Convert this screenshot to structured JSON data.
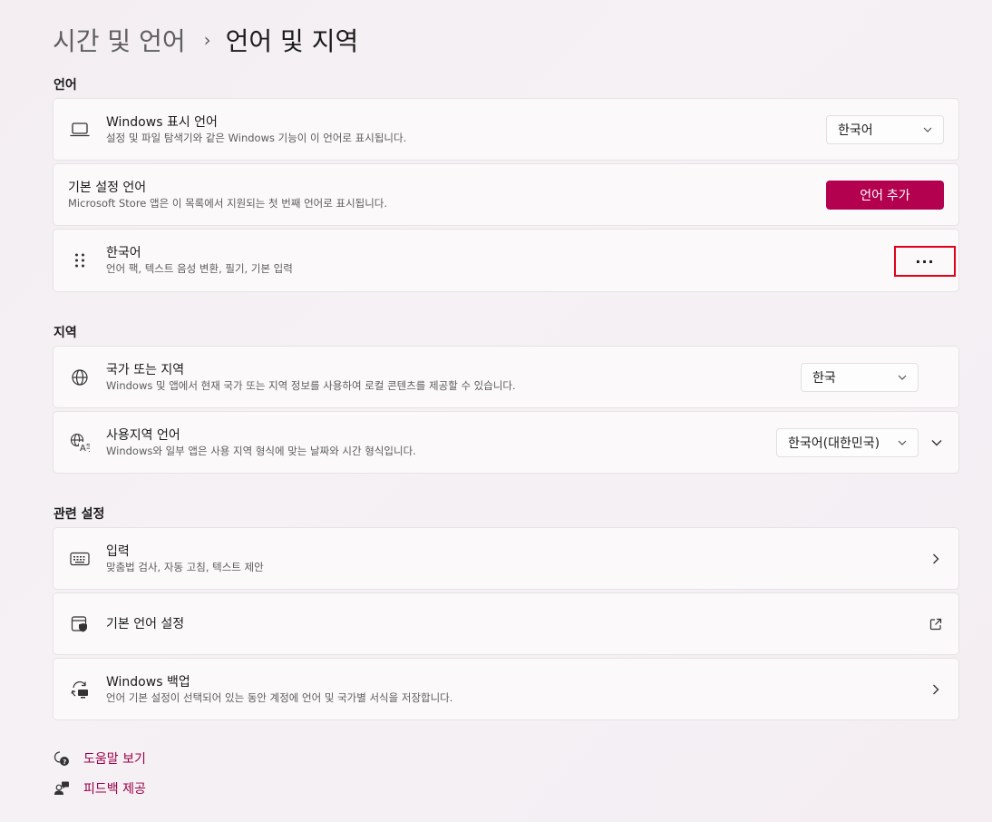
{
  "breadcrumb": {
    "parent": "시간 및 언어",
    "separator": "›",
    "current": "언어 및 지역"
  },
  "sections": {
    "language": "언어",
    "region": "지역",
    "related": "관련 설정"
  },
  "display_language": {
    "title": "Windows 표시 언어",
    "subtitle": "설정 및 파일 탐색기와 같은 Windows 기능이 이 언어로 표시됩니다.",
    "value": "한국어",
    "icon": "laptop-icon"
  },
  "preferred_languages": {
    "title": "기본 설정 언어",
    "subtitle": "Microsoft Store 앱은 이 목록에서 지원되는 첫 번째 언어로 표시됩니다.",
    "add_button": "언어 추가"
  },
  "korean_language": {
    "title": "한국어",
    "subtitle": "언어 팩, 텍스트 음성 변환, 필기, 기본 입력",
    "more": "···",
    "icon": "drag-handle-icon"
  },
  "country_region": {
    "title": "국가 또는 지역",
    "subtitle": "Windows 및 앱에서 현재 국가 또는 지역 정보를 사용하여 로컬 콘텐츠를 제공할 수 있습니다.",
    "value": "한국",
    "icon": "globe-icon"
  },
  "regional_format": {
    "title": "사용지역 언어",
    "subtitle": "Windows와 일부 앱은 사용 지역 형식에 맞는 날짜와 시간 형식입니다.",
    "value": "한국어(대한민국)",
    "icon": "regional-format-icon"
  },
  "typing": {
    "title": "입력",
    "subtitle": "맞춤법 검사, 자동 고침, 텍스트 제안",
    "icon": "keyboard-icon"
  },
  "admin_language": {
    "title": "기본 언어 설정",
    "icon": "shield-window-icon"
  },
  "windows_backup": {
    "title": "Windows 백업",
    "subtitle": "언어 기본 설정이 선택되어 있는 동안 계정에 언어 및 국가별 서식을 저장합니다.",
    "icon": "backup-sync-icon"
  },
  "footer": {
    "help": "도움말 보기",
    "feedback": "피드백 제공"
  },
  "colors": {
    "accent": "#b3004f",
    "link": "#9c0048",
    "highlight": "#e3001b"
  }
}
